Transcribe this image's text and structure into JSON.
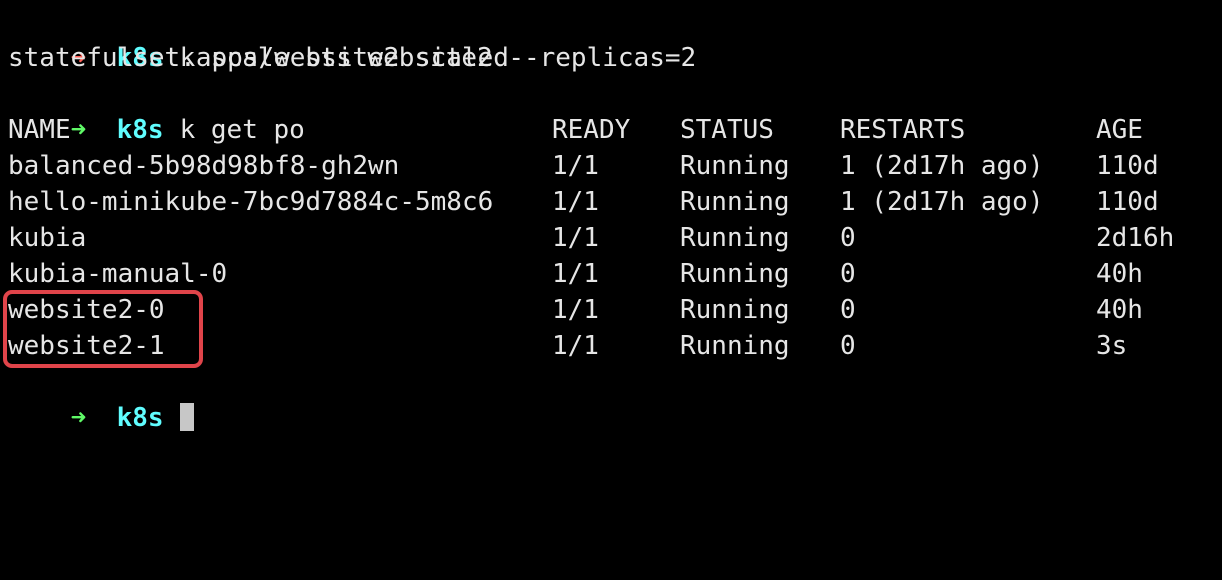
{
  "session": {
    "commands": [
      {
        "arrow": "➜",
        "status": "fail",
        "dir": "k8s",
        "command": "k scale sts website2 --replicas=2"
      },
      {
        "arrow": "➜",
        "status": "ok",
        "dir": "k8s",
        "command": "k get po"
      }
    ],
    "scale_output": "statefulset.apps/website2 scaled",
    "prompt": {
      "arrow": "➜",
      "dir": "k8s"
    }
  },
  "pods_table": {
    "headers": {
      "name": "NAME",
      "ready": "READY",
      "status": "STATUS",
      "restarts": "RESTARTS",
      "age": "AGE"
    },
    "rows": [
      {
        "name": "balanced-5b98d98bf8-gh2wn",
        "ready": "1/1",
        "status": "Running",
        "restarts": "1 (2d17h ago)",
        "age": "110d"
      },
      {
        "name": "hello-minikube-7bc9d7884c-5m8c6",
        "ready": "1/1",
        "status": "Running",
        "restarts": "1 (2d17h ago)",
        "age": "110d"
      },
      {
        "name": "kubia",
        "ready": "1/1",
        "status": "Running",
        "restarts": "0",
        "age": "2d16h"
      },
      {
        "name": "kubia-manual-0",
        "ready": "1/1",
        "status": "Running",
        "restarts": "0",
        "age": "40h"
      },
      {
        "name": "website2-0",
        "ready": "1/1",
        "status": "Running",
        "restarts": "0",
        "age": "40h"
      },
      {
        "name": "website2-1",
        "ready": "1/1",
        "status": "Running",
        "restarts": "0",
        "age": "3s"
      }
    ]
  },
  "colors": {
    "background": "#000000",
    "text": "#e6e6e6",
    "arrow_fail": "#ff5f56",
    "arrow_ok": "#5ff967",
    "dir": "#60fdff",
    "highlight": "#e0444a"
  }
}
